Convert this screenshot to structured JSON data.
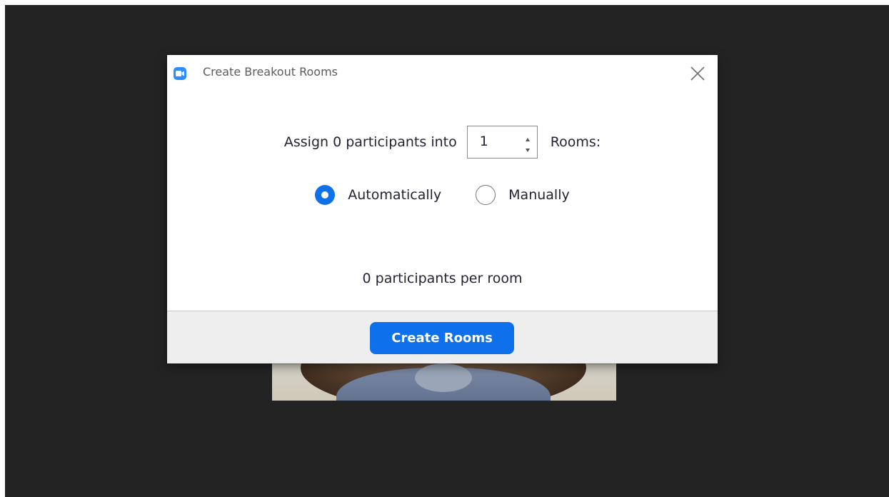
{
  "dialog": {
    "title": "Create Breakout Rooms",
    "app_icon": "zoom-camera-icon",
    "close_icon": "close-icon"
  },
  "assign": {
    "prefix": "Assign 0 participants into",
    "room_count": "1",
    "suffix": "Rooms:"
  },
  "assignment_mode": {
    "options": [
      {
        "label": "Automatically",
        "selected": true
      },
      {
        "label": "Manually",
        "selected": false
      }
    ]
  },
  "summary": {
    "per_room_text": "0 participants per room"
  },
  "footer": {
    "create_label": "Create Rooms"
  },
  "colors": {
    "accent": "#0E71EB",
    "app_background": "#232323",
    "footer_background": "#EEEEEE"
  }
}
